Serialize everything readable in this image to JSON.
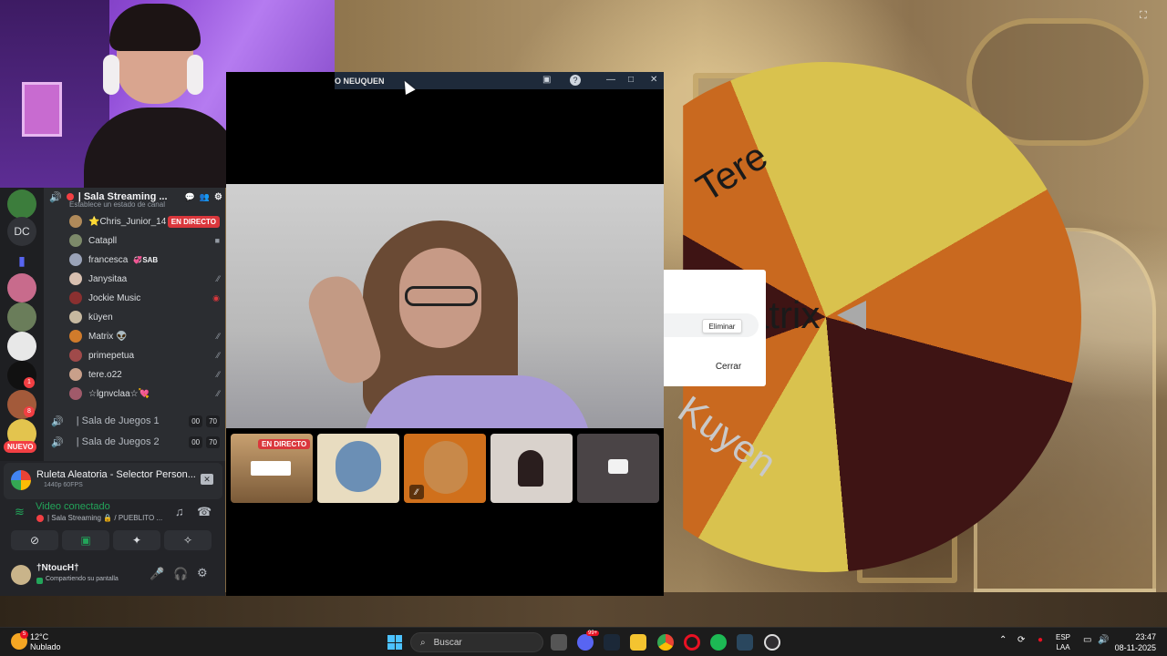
{
  "webcam": {},
  "discord": {
    "servers": {
      "dc_label": "DC",
      "nuevo_label": "NUEVO",
      "badge1": "1",
      "badge2": "8"
    },
    "voice_channel": {
      "name": "| Sala Streaming ...",
      "status_placeholder": "Establece un estado de canal"
    },
    "members": [
      {
        "name": "⭐Chris_Junior_14",
        "tag": "EN DIRECTO"
      },
      {
        "name": "Catapll"
      },
      {
        "name": "francesca",
        "tag": "💞SAB"
      },
      {
        "name": "Janysitaa"
      },
      {
        "name": "Jockie Music"
      },
      {
        "name": "küyen"
      },
      {
        "name": "Matrix 👽"
      },
      {
        "name": "primepetua"
      },
      {
        "name": "tere.o22"
      },
      {
        "name": "☆lgnvclaa☆💘"
      }
    ],
    "rooms": [
      {
        "name": "| Sala de Juegos 1",
        "count_a": "00",
        "count_b": "70"
      },
      {
        "name": "| Sala de Juegos 2",
        "count_a": "00",
        "count_b": "70"
      }
    ],
    "activity": {
      "title": "Ruleta Aleatoria - Selector Person...",
      "subtitle": "1440p 60FPS"
    },
    "voice_status": {
      "label": "Video conectado",
      "channel": "| Sala Streaming 🔒 / PUEBLITO ..."
    },
    "user": {
      "name": "†NtoucH†",
      "status": "Compartiendo su pantalla"
    }
  },
  "video_window": {
    "title": "O NEUQUEN",
    "live_tag": "EN DIRECTO"
  },
  "wheel": {
    "labels": [
      "Tere",
      "atrix",
      "Kuyen"
    ],
    "delete_label": "Eliminar",
    "close_label": "Cerrar"
  },
  "taskbar": {
    "temp": "12°C",
    "condition": "Nublado",
    "weather_badge": "5",
    "search_placeholder": "Buscar",
    "chat_badge": "99+",
    "lang_top": "ESP",
    "lang_bottom": "LAA",
    "time": "23:47",
    "date": "08-11-2025"
  },
  "colors": {
    "discord_bg": "#2b2d31",
    "live_red": "#da373c",
    "connected_green": "#23a55a",
    "wheel_yellow": "#d9c24e",
    "wheel_orange": "#c9691f",
    "wheel_dark": "#3e1414"
  }
}
